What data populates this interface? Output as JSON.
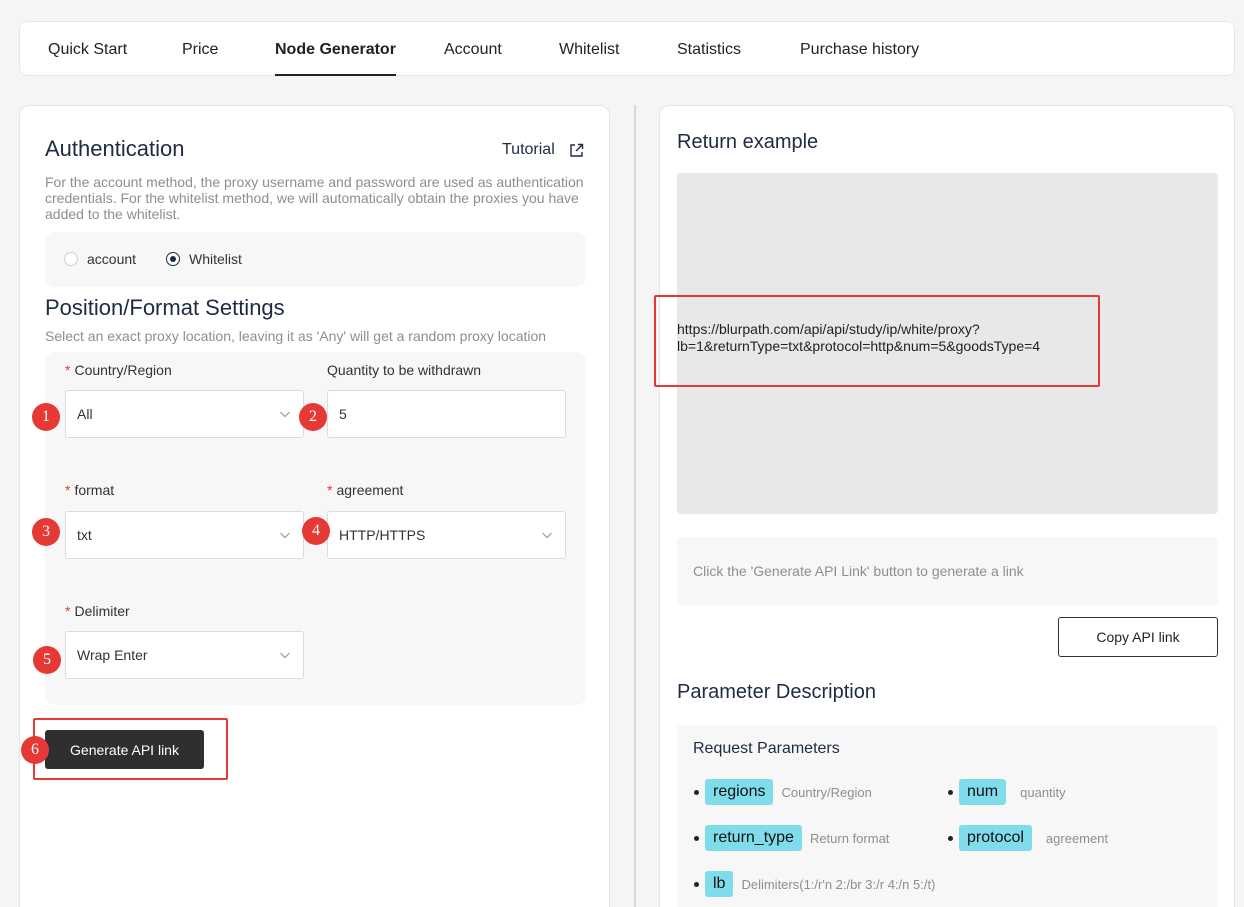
{
  "nav": {
    "tabs": [
      {
        "label": "Quick Start",
        "active": false
      },
      {
        "label": "Price",
        "active": false
      },
      {
        "label": "Node Generator",
        "active": true
      },
      {
        "label": "Account",
        "active": false
      },
      {
        "label": "Whitelist",
        "active": false
      },
      {
        "label": "Statistics",
        "active": false
      },
      {
        "label": "Purchase history",
        "active": false
      }
    ]
  },
  "auth": {
    "title": "Authentication",
    "tutorial": "Tutorial",
    "desc_line1": "For the account method, the proxy username and password are used as authentication",
    "desc_line2": "credentials. For the whitelist method, we will automatically obtain the proxies you have",
    "desc_line3": "added to the whitelist.",
    "options": [
      {
        "label": "account",
        "checked": false
      },
      {
        "label": "Whitelist",
        "checked": true
      }
    ]
  },
  "position": {
    "title": "Position/Format Settings",
    "desc": "Select an exact proxy location, leaving it as 'Any' will get a random proxy location",
    "fields": {
      "country": {
        "label": "Country/Region",
        "value": "All",
        "required": true,
        "badge": "1"
      },
      "quantity": {
        "label": "Quantity to be withdrawn",
        "value": "5",
        "required": false,
        "badge": "2"
      },
      "format": {
        "label": "format",
        "value": "txt",
        "required": true,
        "badge": "3"
      },
      "agreement": {
        "label": "agreement",
        "value": "HTTP/HTTPS",
        "required": true,
        "badge": "4"
      },
      "delimiter": {
        "label": "Delimiter",
        "value": "Wrap Enter",
        "required": true,
        "badge": "5"
      }
    },
    "generate_label": "Generate API link",
    "generate_badge": "6"
  },
  "example": {
    "title": "Return example",
    "url_line1": "https://blurpath.com/api/api/study/ip/white/proxy?",
    "url_line2": "lb=1&returnType=txt&protocol=http&num=5&goodsType=4",
    "hint": "Click the 'Generate API Link' button to generate a link",
    "copy_label": "Copy API link"
  },
  "params": {
    "title": "Parameter Description",
    "subtitle": "Request Parameters",
    "items": [
      {
        "name": "regions",
        "desc": "Country/Region"
      },
      {
        "name": "num",
        "desc": "quantity"
      },
      {
        "name": "return_type",
        "desc": "Return format"
      },
      {
        "name": "protocol",
        "desc": "agreement"
      },
      {
        "name": "lb",
        "desc": "Delimiters(1:/r'n 2:/br 3:/r 4:/n 5:/t)"
      }
    ]
  },
  "colors": {
    "accent": "#1f2a44",
    "annotation": "#e53935",
    "chip": "#7fdcea"
  }
}
